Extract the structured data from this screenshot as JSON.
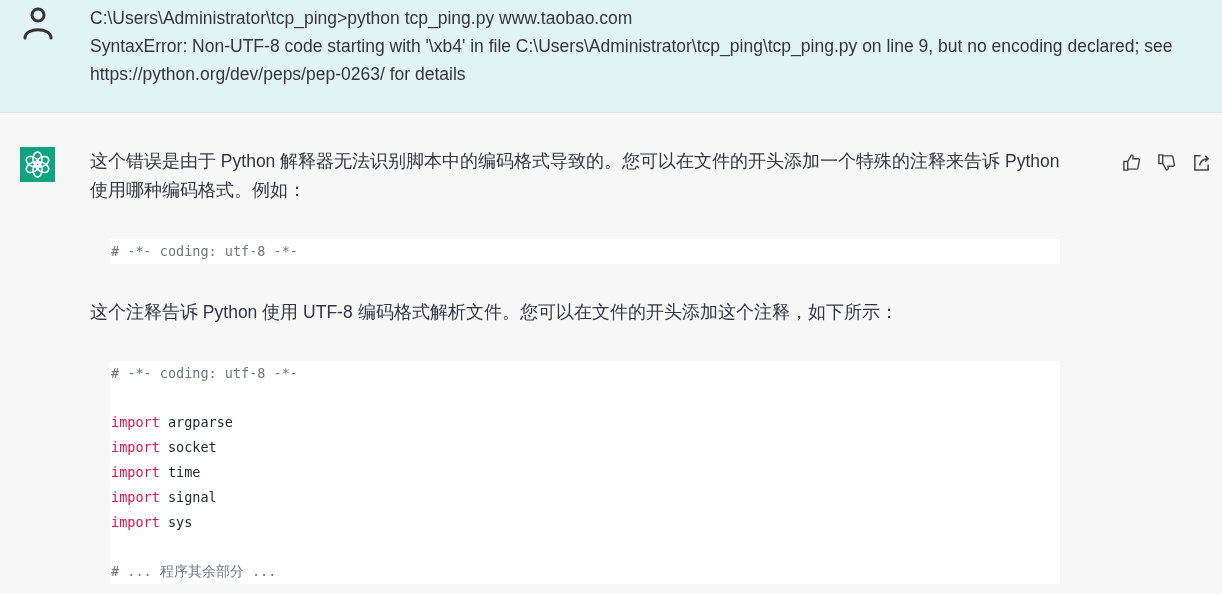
{
  "user_message": {
    "lines": [
      "C:\\Users\\Administrator\\tcp_ping>python tcp_ping.py www.taobao.com",
      "SyntaxError: Non-UTF-8 code starting with '\\xb4' in file C:\\Users\\Administrator\\tcp_ping\\tcp_ping.py on line 9, but no encoding declared; see https://python.org/dev/peps/pep-0263/ for details"
    ]
  },
  "assistant_message": {
    "blocks": [
      {
        "kind": "text",
        "text": "这个错误是由于 Python 解释器无法识别脚本中的编码格式导致的。您可以在文件的开头添加一个特殊的注释来告诉 Python 使用哪种编码格式。例如："
      },
      {
        "kind": "code",
        "lines": [
          {
            "kind": "comment",
            "text": "# -*- coding: utf-8 -*-"
          }
        ]
      },
      {
        "kind": "text",
        "text": "这个注释告诉 Python 使用 UTF-8 编码格式解析文件。您可以在文件的开头添加这个注释，如下所示："
      },
      {
        "kind": "code",
        "lines": [
          {
            "kind": "comment",
            "text": "# -*- coding: utf-8 -*-"
          },
          {
            "kind": "blank"
          },
          {
            "kind": "import",
            "keyword": "import",
            "name": "argparse"
          },
          {
            "kind": "import",
            "keyword": "import",
            "name": "socket"
          },
          {
            "kind": "import",
            "keyword": "import",
            "name": "time"
          },
          {
            "kind": "import",
            "keyword": "import",
            "name": "signal"
          },
          {
            "kind": "import",
            "keyword": "import",
            "name": "sys"
          },
          {
            "kind": "blank"
          },
          {
            "kind": "comment",
            "text": "# ... 程序其余部分 ..."
          }
        ]
      }
    ]
  }
}
